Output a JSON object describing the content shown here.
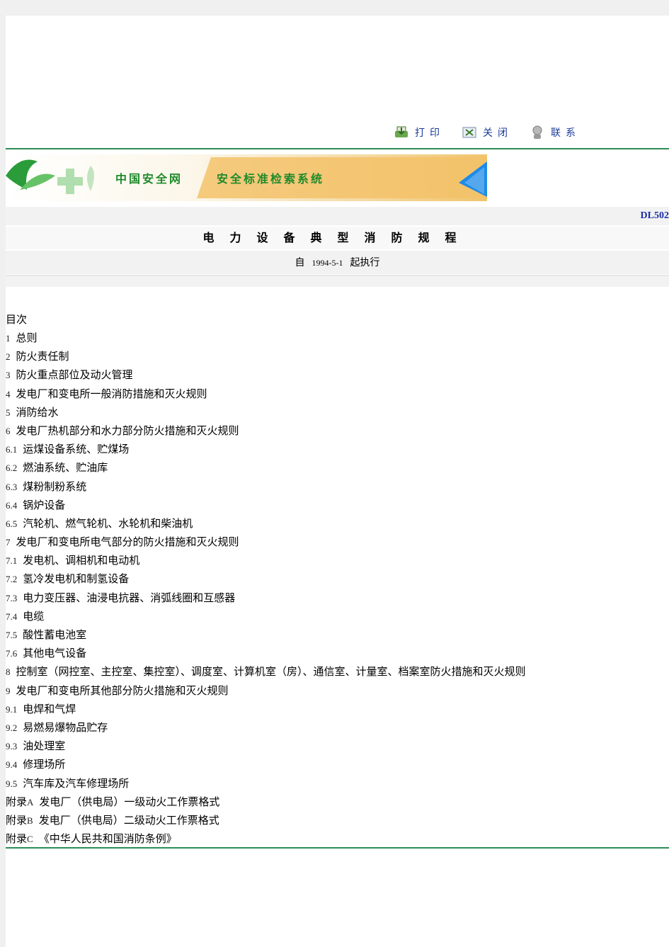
{
  "toolbar": {
    "print_label": "打印",
    "close_label": "关闭",
    "contact_label": "联系"
  },
  "banner": {
    "site_name": "中国安全网",
    "system_name": "安全标准检索系统"
  },
  "document": {
    "code": "DL502",
    "title": "电力设备典型消防规程",
    "effective_prefix": "自",
    "effective_date": "1994-5-1",
    "effective_suffix": "起执行"
  },
  "toc": {
    "heading": "目次",
    "items": [
      {
        "num": "1",
        "text": "总则"
      },
      {
        "num": "2",
        "text": "防火责任制"
      },
      {
        "num": "3",
        "text": "防火重点部位及动火管理"
      },
      {
        "num": "4",
        "text": "发电厂和变电所一般消防措施和灭火规则"
      },
      {
        "num": "5",
        "text": "消防给水"
      },
      {
        "num": "6",
        "text": "发电厂热机部分和水力部分防火措施和灭火规则"
      },
      {
        "num": "6.1",
        "text": "运煤设备系统、贮煤场"
      },
      {
        "num": "6.2",
        "text": "燃油系统、贮油库"
      },
      {
        "num": "6.3",
        "text": "煤粉制粉系统"
      },
      {
        "num": "6.4",
        "text": "锅炉设备"
      },
      {
        "num": "6.5",
        "text": "汽轮机、燃气轮机、水轮机和柴油机"
      },
      {
        "num": "7",
        "text": "发电厂和变电所电气部分的防火措施和灭火规则"
      },
      {
        "num": "7.1",
        "text": "发电机、调相机和电动机"
      },
      {
        "num": "7.2",
        "text": "氢冷发电机和制氢设备"
      },
      {
        "num": "7.3",
        "text": "电力变压器、油浸电抗器、消弧线圈和互感器"
      },
      {
        "num": "7.4",
        "text": "电缆"
      },
      {
        "num": "7.5",
        "text": "酸性蓄电池室"
      },
      {
        "num": "7.6",
        "text": "其他电气设备"
      },
      {
        "num": "8",
        "text": "控制室（网控室、主控室、集控室）、调度室、计算机室（房）、通信室、计量室、档案室防火措施和灭火规则"
      },
      {
        "num": "9",
        "text": "发电厂和变电所其他部分防火措施和灭火规则"
      },
      {
        "num": "9.1",
        "text": "电焊和气焊"
      },
      {
        "num": "9.2",
        "text": "易燃易爆物品贮存"
      },
      {
        "num": "9.3",
        "text": "油处理室"
      },
      {
        "num": "9.4",
        "text": "修理场所"
      },
      {
        "num": "9.5",
        "text": "汽车库及汽车修理场所"
      }
    ],
    "appendices": [
      {
        "prefix": "附录",
        "letter": "A",
        "text": "发电厂（供电局）一级动火工作票格式"
      },
      {
        "prefix": "附录",
        "letter": "B",
        "text": "发电厂（供电局）二级动火工作票格式"
      },
      {
        "prefix": "附录",
        "letter": "C",
        "text": "《中华人民共和国消防条例》"
      }
    ]
  },
  "colors": {
    "rule": "#2e8b57",
    "link_blue": "#1a3a9a",
    "code_blue": "#1b2ea8",
    "banner_orange": "#f3c26a",
    "banner_green": "#2a9d3a"
  }
}
